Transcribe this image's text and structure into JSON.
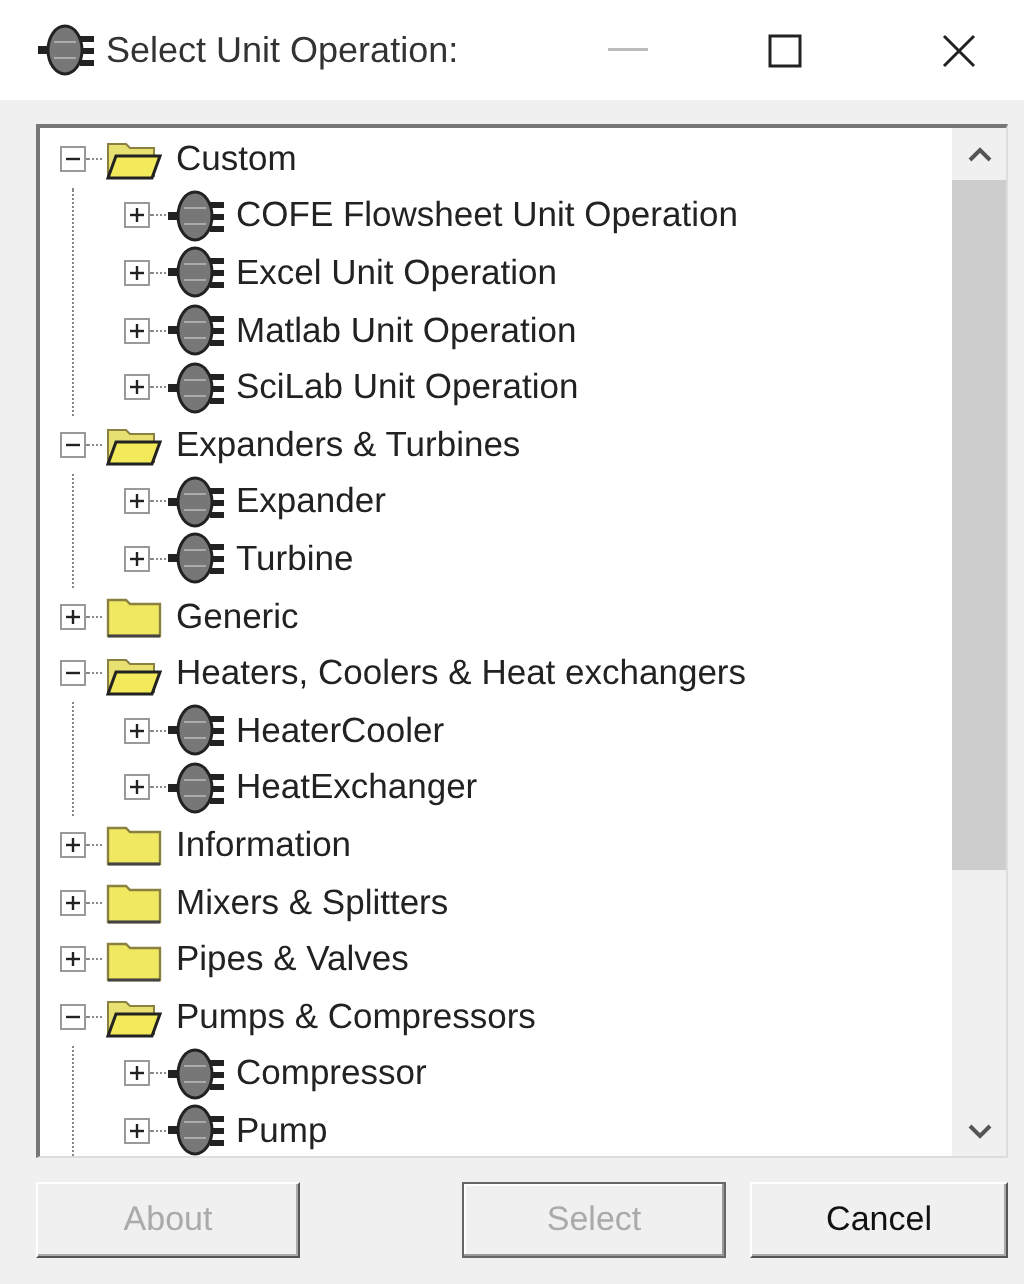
{
  "window": {
    "title": "Select Unit Operation:"
  },
  "tree": [
    {
      "label": "Custom",
      "kind": "folder",
      "expanded": true,
      "children": [
        {
          "label": "COFE Flowsheet Unit Operation",
          "kind": "unit",
          "expanded": false
        },
        {
          "label": "Excel Unit Operation",
          "kind": "unit",
          "expanded": false
        },
        {
          "label": "Matlab Unit Operation",
          "kind": "unit",
          "expanded": false
        },
        {
          "label": "SciLab Unit Operation",
          "kind": "unit",
          "expanded": false
        }
      ]
    },
    {
      "label": "Expanders & Turbines",
      "kind": "folder",
      "expanded": true,
      "children": [
        {
          "label": "Expander",
          "kind": "unit",
          "expanded": false
        },
        {
          "label": "Turbine",
          "kind": "unit",
          "expanded": false
        }
      ]
    },
    {
      "label": "Generic",
      "kind": "folder",
      "expanded": false
    },
    {
      "label": "Heaters, Coolers & Heat exchangers",
      "kind": "folder",
      "expanded": true,
      "children": [
        {
          "label": "HeaterCooler",
          "kind": "unit",
          "expanded": false
        },
        {
          "label": "HeatExchanger",
          "kind": "unit",
          "expanded": false
        }
      ]
    },
    {
      "label": "Information",
      "kind": "folder",
      "expanded": false
    },
    {
      "label": "Mixers & Splitters",
      "kind": "folder",
      "expanded": false
    },
    {
      "label": "Pipes & Valves",
      "kind": "folder",
      "expanded": false
    },
    {
      "label": "Pumps & Compressors",
      "kind": "folder",
      "expanded": true,
      "children": [
        {
          "label": "Compressor",
          "kind": "unit",
          "expanded": false
        },
        {
          "label": "Pump",
          "kind": "unit",
          "expanded": false
        }
      ]
    }
  ],
  "buttons": [
    {
      "label": "About",
      "disabled": true
    },
    {
      "label": "Select",
      "disabled": true
    },
    {
      "label": "Cancel",
      "disabled": false
    }
  ]
}
